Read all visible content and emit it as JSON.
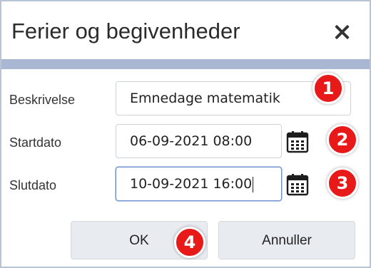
{
  "dialog": {
    "title": "Ferier og begivenheder",
    "close_icon": "close-icon"
  },
  "form": {
    "description": {
      "label": "Beskrivelse",
      "value": "Emnedage matematik"
    },
    "start": {
      "label": "Startdato",
      "value": "06-09-2021 08:00",
      "icon": "calendar-icon"
    },
    "end": {
      "label": "Slutdato",
      "value": "10-09-2021 16:00",
      "icon": "calendar-icon"
    }
  },
  "buttons": {
    "ok": "OK",
    "cancel": "Annuller"
  },
  "badges": [
    "1",
    "2",
    "3",
    "4"
  ],
  "colors": {
    "accent_bar": "#a9b7d3",
    "badge": "#e81919",
    "button_bg": "#e8ebf0"
  }
}
